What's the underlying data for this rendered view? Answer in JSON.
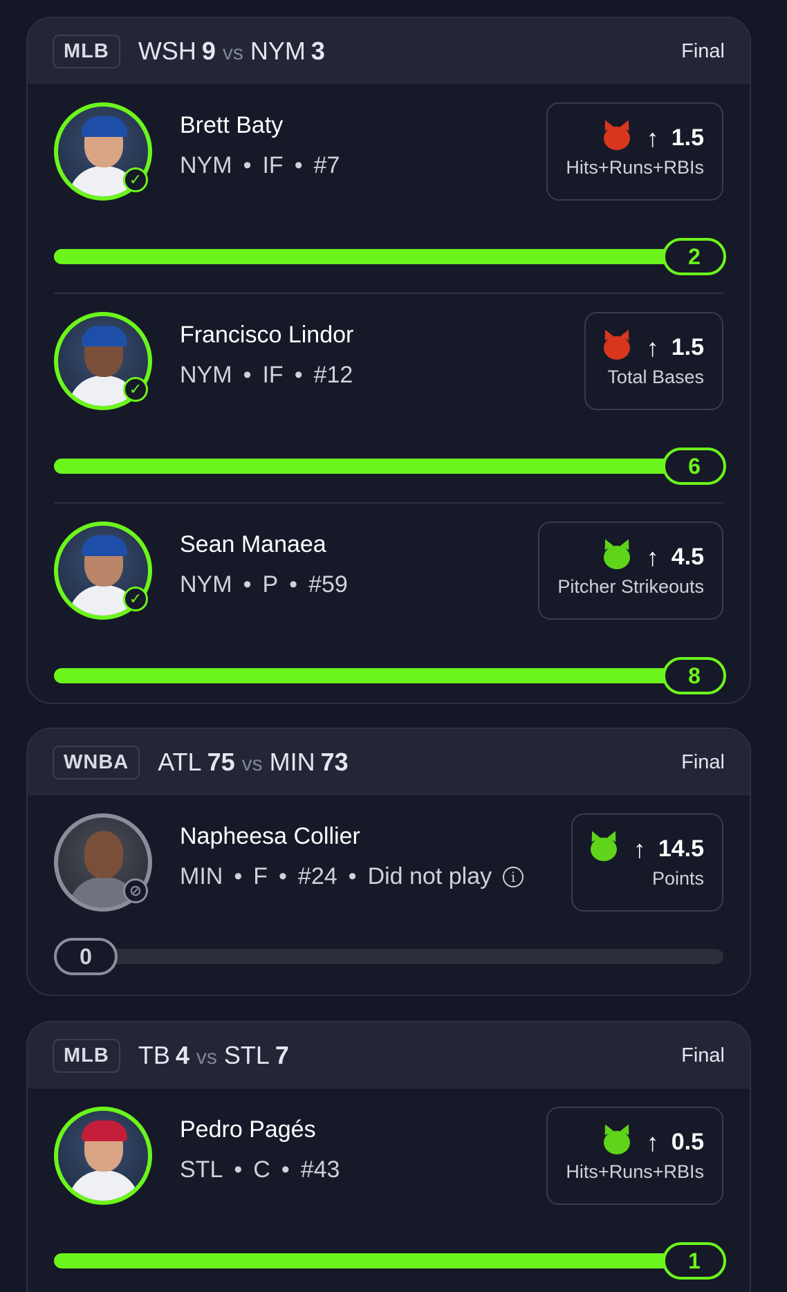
{
  "colors": {
    "accent": "#6cf51c",
    "background": "#141725",
    "card": "#161927",
    "header": "#222636"
  },
  "games": [
    {
      "league": "MLB",
      "team1": "WSH",
      "score1": "9",
      "vs": "vs",
      "team2": "NYM",
      "score2": "3",
      "status": "Final",
      "players": [
        {
          "name": "Brett Baty",
          "team": "NYM",
          "position": "IF",
          "number": "#7",
          "status_icon": "check-icon",
          "pick_icon": "red-devil-icon",
          "direction": "↑",
          "line": "1.5",
          "stat": "Hits+Runs+RBIs",
          "actual": "2",
          "progress": 1.0
        },
        {
          "name": "Francisco Lindor",
          "team": "NYM",
          "position": "IF",
          "number": "#12",
          "status_icon": "check-icon",
          "pick_icon": "red-devil-icon",
          "direction": "↑",
          "line": "1.5",
          "stat": "Total Bases",
          "actual": "6",
          "progress": 1.0
        },
        {
          "name": "Sean Manaea",
          "team": "NYM",
          "position": "P",
          "number": "#59",
          "status_icon": "check-icon",
          "pick_icon": "green-devil-icon",
          "direction": "↑",
          "line": "4.5",
          "stat": "Pitcher Strikeouts",
          "actual": "8",
          "progress": 1.0
        }
      ]
    },
    {
      "league": "WNBA",
      "team1": "ATL",
      "score1": "75",
      "vs": "vs",
      "team2": "MIN",
      "score2": "73",
      "status": "Final",
      "players": [
        {
          "name": "Napheesa Collier",
          "team": "MIN",
          "position": "F",
          "number": "#24",
          "note": "Did not play",
          "status_icon": "prohibited-icon",
          "pick_icon": "green-devil-icon",
          "direction": "↑",
          "line": "14.5",
          "stat": "Points",
          "actual": "0",
          "progress": 0.0
        }
      ]
    },
    {
      "league": "MLB",
      "team1": "TB",
      "score1": "4",
      "vs": "vs",
      "team2": "STL",
      "score2": "7",
      "status": "Final",
      "players": [
        {
          "name": "Pedro Pagés",
          "team": "STL",
          "position": "C",
          "number": "#43",
          "status_icon": "none",
          "pick_icon": "green-devil-icon",
          "direction": "↑",
          "line": "0.5",
          "stat": "Hits+Runs+RBIs",
          "actual": "1",
          "progress": 1.0
        }
      ]
    }
  ],
  "separator": "•",
  "info_icon": "info-icon"
}
